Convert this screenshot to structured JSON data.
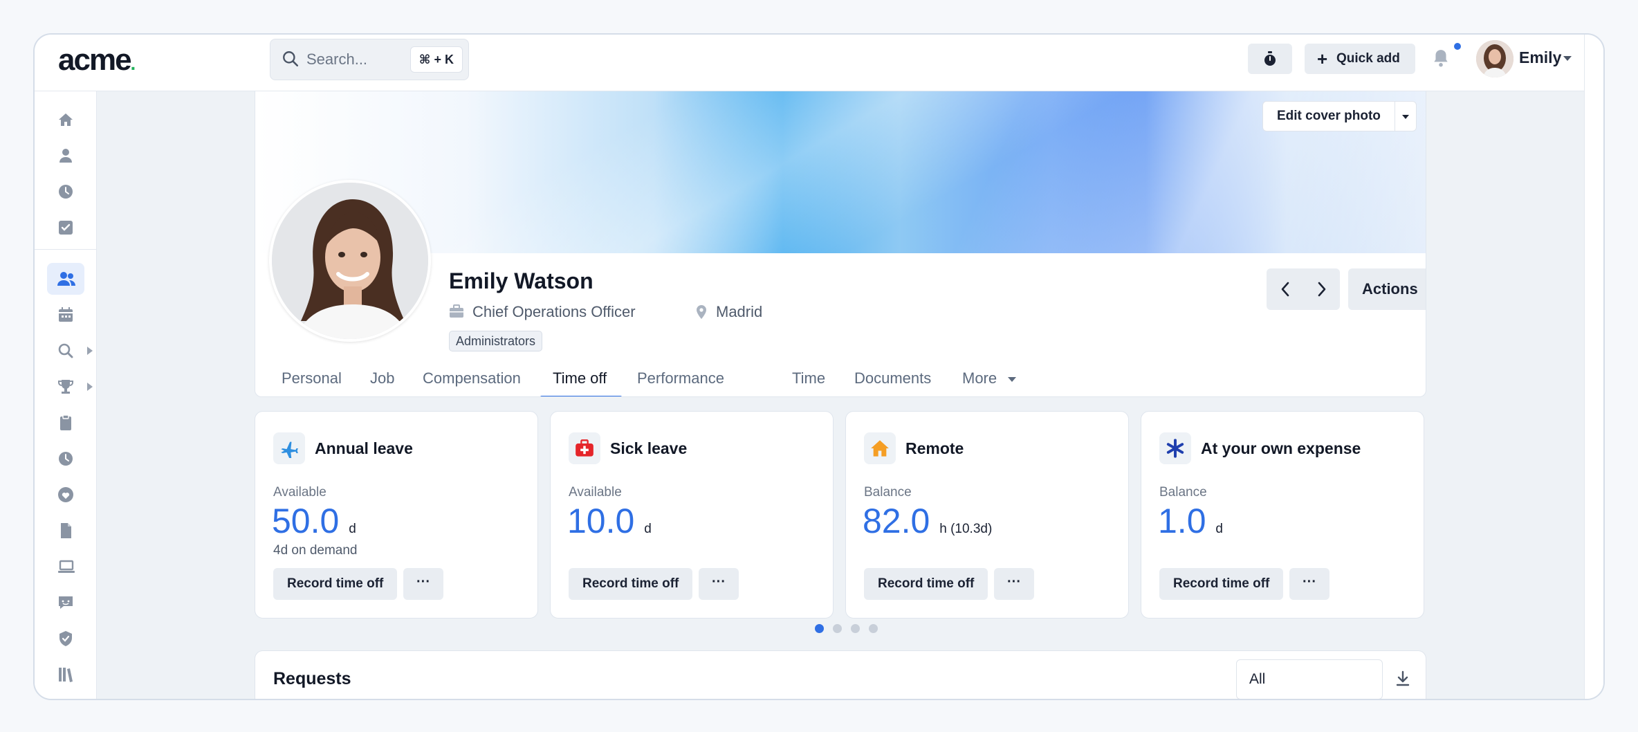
{
  "app": {
    "logo": "acme",
    "logo_dot": "."
  },
  "search": {
    "placeholder": "Search...",
    "shortcut": "⌘ + K"
  },
  "topbar": {
    "quick_add_label": "Quick add",
    "user_name": "Emily",
    "notifications_unread": true
  },
  "sidebar": {
    "items": [
      {
        "icon": "home-icon"
      },
      {
        "icon": "user-icon"
      },
      {
        "icon": "clock-icon"
      },
      {
        "icon": "checkbox-icon"
      },
      {
        "icon": "people-icon",
        "active": true
      },
      {
        "icon": "calendar-icon"
      },
      {
        "icon": "search-icon",
        "expandable": true
      },
      {
        "icon": "trophy-icon",
        "expandable": true
      },
      {
        "icon": "clipboard-icon"
      },
      {
        "icon": "clock-icon"
      },
      {
        "icon": "heart-icon"
      },
      {
        "icon": "document-icon"
      },
      {
        "icon": "laptop-icon"
      },
      {
        "icon": "chat-icon"
      },
      {
        "icon": "shield-icon"
      },
      {
        "icon": "library-icon"
      }
    ]
  },
  "profile": {
    "cover_button": "Edit cover photo",
    "name": "Emily Watson",
    "job_title": "Chief Operations Officer",
    "location": "Madrid",
    "badge": "Administrators",
    "actions_label": "Actions",
    "tabs": [
      {
        "label": "Personal"
      },
      {
        "label": "Job"
      },
      {
        "label": "Compensation"
      },
      {
        "label": "Time off",
        "active": true
      },
      {
        "label": "Performance"
      },
      {
        "label": "Time"
      },
      {
        "label": "Documents"
      },
      {
        "label": "More"
      }
    ]
  },
  "leave_cards": [
    {
      "title": "Annual leave",
      "caption": "Available",
      "value": "50.0",
      "unit": "d",
      "sub": "4d on demand",
      "button": "Record time off",
      "more": "···",
      "icon": "airplane-icon",
      "icon_color": "#2f8fe0"
    },
    {
      "title": "Sick leave",
      "caption": "Available",
      "value": "10.0",
      "unit": "d",
      "sub": "",
      "button": "Record time off",
      "more": "···",
      "icon": "first-aid-icon",
      "icon_color": "#e5252a"
    },
    {
      "title": "Remote",
      "caption": "Balance",
      "value": "82.0",
      "unit": "h (10.3d)",
      "sub": "",
      "button": "Record time off",
      "more": "···",
      "icon": "house-icon",
      "icon_color": "#f59e24"
    },
    {
      "title": "At your own expense",
      "caption": "Balance",
      "value": "1.0",
      "unit": "d",
      "sub": "",
      "button": "Record time off",
      "more": "···",
      "icon": "asterisk-icon",
      "icon_color": "#1f3fae"
    }
  ],
  "carousel": {
    "total": 4,
    "active_index": 0
  },
  "requests": {
    "title": "Requests",
    "filter_value": "All"
  },
  "colors": {
    "accent": "#2f6fe4",
    "brand_dot": "#22b05a"
  }
}
